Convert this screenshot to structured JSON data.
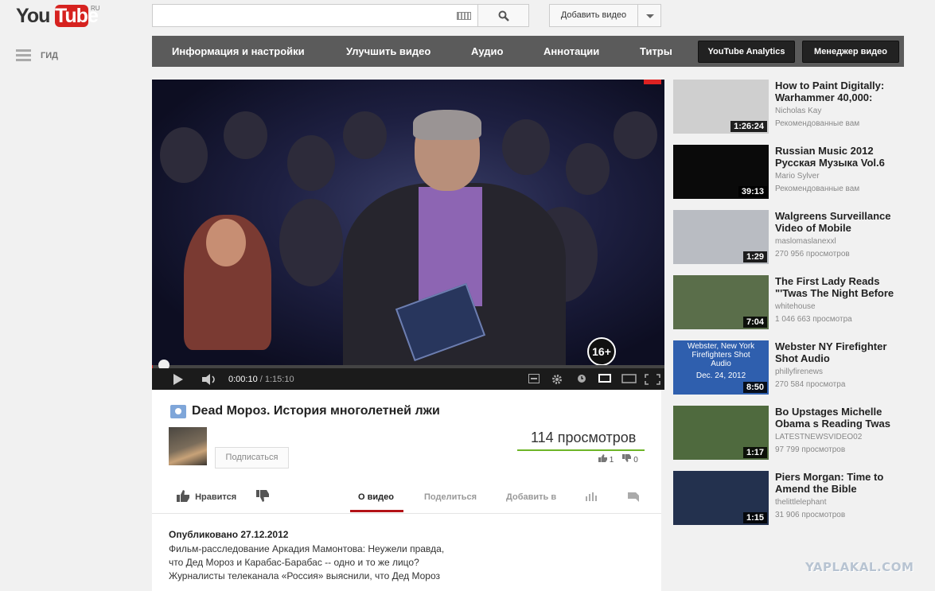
{
  "header": {
    "logo_you": "You",
    "logo_tube": "Tube",
    "logo_region": "RU",
    "search_placeholder": "",
    "upload_label": "Добавить видео"
  },
  "guide": {
    "label": "ГИД"
  },
  "owner_bar": {
    "items": [
      "Информация и настройки",
      "Улучшить видео",
      "Аудио",
      "Аннотации",
      "Титры"
    ],
    "analytics": "YouTube Analytics",
    "manager": "Менеджер видео"
  },
  "player": {
    "current_time": "0:00:10",
    "separator": " / ",
    "duration": "1:15:10",
    "progress_fraction": 0.0022,
    "age_badge": "16+"
  },
  "video": {
    "title": "Dead Мороз. История многолетней лжи",
    "subscribe_label": "Подписаться",
    "views": "114 просмотров",
    "likes": "1",
    "dislikes": "0",
    "like_label": "Нравится",
    "tabs": [
      "О видео",
      "Поделиться",
      "Добавить в"
    ],
    "published": "Опубликовано 27.12.2012",
    "description": [
      "Фильм-расследование Аркадия Мамонтова: Неужели правда,",
      "что Дед Мороз и Карабас-Барабас -- одно и то же лицо?",
      "Журналисты телеканала «Россия» выяснили, что Дед Мороз"
    ]
  },
  "related": [
    {
      "title": "How to Paint Digitally: Warhammer 40,000:",
      "channel": "Nicholas Kay",
      "meta": "Рекомендованные вам",
      "duration": "1:26:24",
      "thumb_color": "#cfcfcf"
    },
    {
      "title": "Russian Music 2012 Русская Музыка Vol.6",
      "channel": "Mario Sylver",
      "meta": "Рекомендованные вам",
      "duration": "39:13",
      "thumb_color": "#0a0a0a"
    },
    {
      "title": "Walgreens Surveillance Video of Mobile",
      "channel": "maslomaslanexxl",
      "meta": "270 956 просмотров",
      "duration": "1:29",
      "thumb_color": "#b9bcc2"
    },
    {
      "title": "The First Lady Reads \"'Twas The Night Before",
      "channel": "whitehouse",
      "meta": "1 046 663 просмотра",
      "duration": "7:04",
      "thumb_color": "#5a6e4a"
    },
    {
      "title": "Webster NY Firefighter Shot Audio",
      "channel": "phillyfirenews",
      "meta": "270 584 просмотра",
      "duration": "8:50",
      "thumb_color": "#2f5fae",
      "thumb_text": [
        "Webster, New York",
        "Firefighters Shot",
        "Audio",
        "Dec. 24, 2012"
      ]
    },
    {
      "title": "Bo Upstages Michelle Obama s Reading Twas",
      "channel": "LATESTNEWSVIDEO02",
      "meta": "97 799 просмотров",
      "duration": "1:17",
      "thumb_color": "#4f6a3e"
    },
    {
      "title": "Piers Morgan: Time to Amend the Bible",
      "channel": "thelittlelephant",
      "meta": "31 906 просмотров",
      "duration": "1:15",
      "thumb_color": "#23314e"
    }
  ],
  "watermark": "YAPLAKAL.COM"
}
